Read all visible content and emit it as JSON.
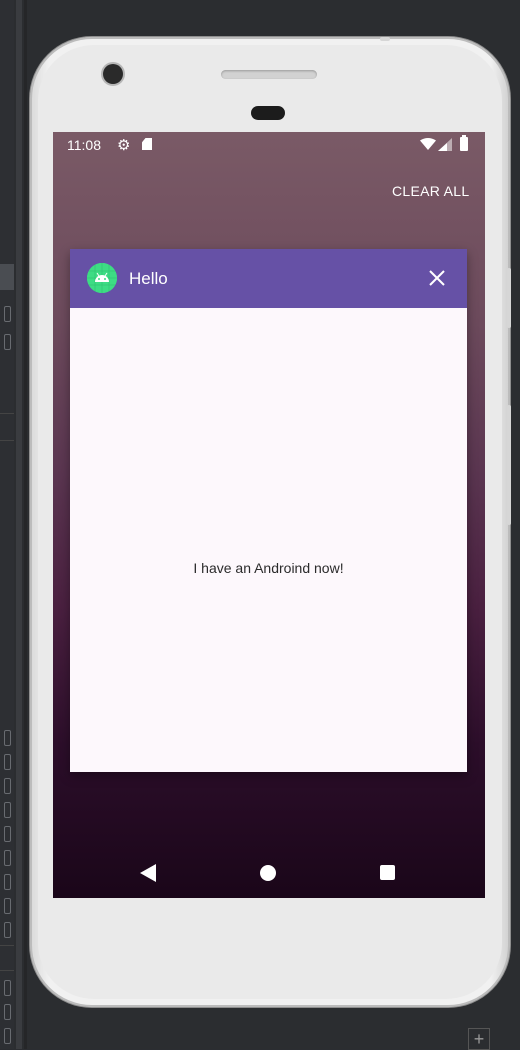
{
  "status_bar": {
    "time": "11:08",
    "icons": [
      "gear-icon",
      "sd-card-icon",
      "wifi-icon",
      "signal-icon",
      "battery-icon"
    ]
  },
  "recents": {
    "clear_all_label": "CLEAR ALL"
  },
  "task": {
    "app_icon": "android-icon",
    "title": "Hello",
    "close_icon": "close-icon",
    "header_color": "#6651a6",
    "body_text": "I have an Androind now!"
  },
  "nav_bar": {
    "icons": [
      "back-icon",
      "home-icon",
      "recents-icon"
    ]
  }
}
